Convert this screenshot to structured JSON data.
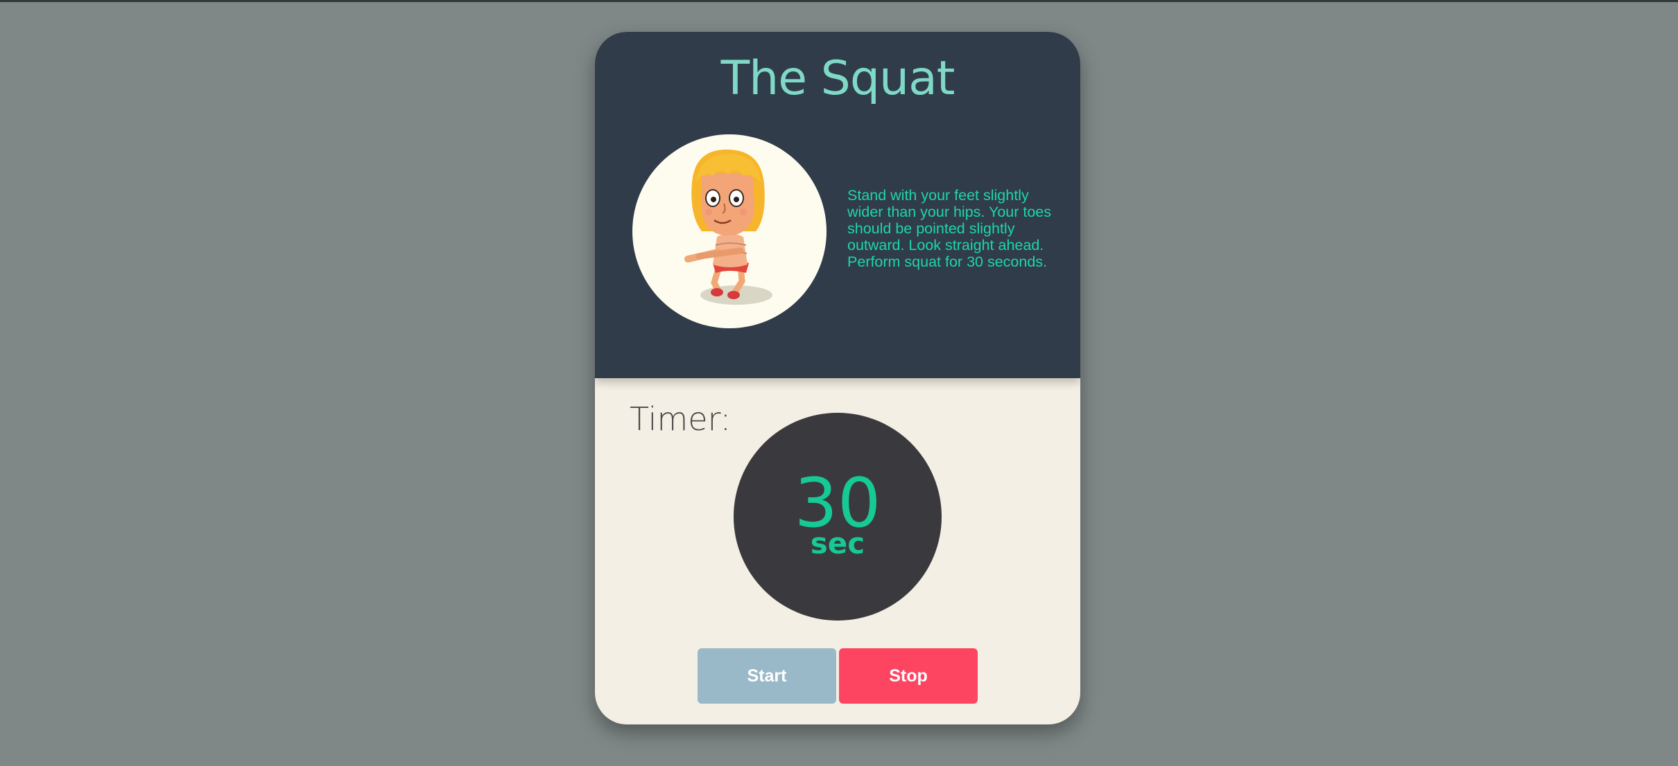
{
  "exercise": {
    "title": "The Squat",
    "description": "Stand with your feet slightly wider than your hips. Your toes should be pointed slightly outward. Look straight ahead. Perform squat for 30 seconds.",
    "illustration_icon": "squatting-character-illustration"
  },
  "timer": {
    "label": "Timer:",
    "value": "30",
    "unit": "sec"
  },
  "controls": {
    "start_label": "Start",
    "stop_label": "Stop"
  },
  "colors": {
    "background": "#7f8887",
    "card_top": "#303c4a",
    "card_bottom": "#f3efe4",
    "title": "#7fd9c6",
    "accent_green": "#17c995",
    "dial": "#3a393e",
    "start_button": "#9ab9c8",
    "stop_button": "#fd4562"
  }
}
